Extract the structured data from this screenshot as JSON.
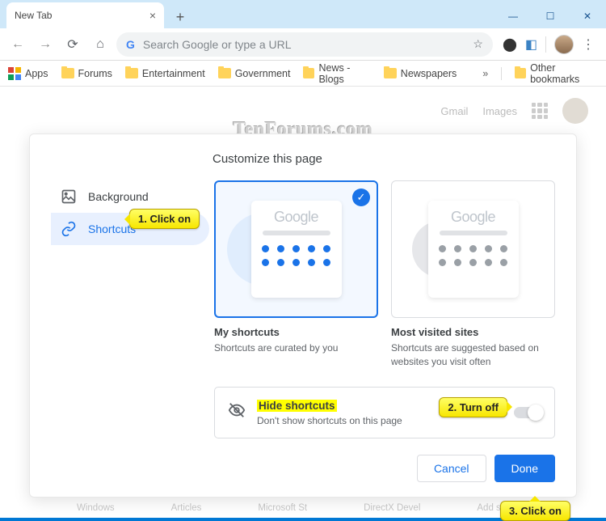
{
  "window": {
    "tab_title": "New Tab"
  },
  "omnibox": {
    "placeholder": "Search Google or type a URL"
  },
  "bookmarks": {
    "apps": "Apps",
    "items": [
      "Forums",
      "Entertainment",
      "Government",
      "News - Blogs",
      "Newspapers"
    ],
    "other": "Other bookmarks"
  },
  "toplinks": {
    "gmail": "Gmail",
    "images": "Images"
  },
  "watermark": "TenForums.com",
  "modal": {
    "title": "Customize this page",
    "nav": {
      "background": "Background",
      "shortcuts": "Shortcuts"
    },
    "cards": {
      "my_shortcuts": {
        "label": "My shortcuts",
        "desc": "Shortcuts are curated by you",
        "logo": "Google"
      },
      "most_visited": {
        "label": "Most visited sites",
        "desc": "Shortcuts are suggested based on websites you visit often",
        "logo": "Google"
      }
    },
    "hide": {
      "title": "Hide shortcuts",
      "desc": "Don't show shortcuts on this page"
    },
    "footer": {
      "cancel": "Cancel",
      "done": "Done"
    }
  },
  "callouts": {
    "c1": "1. Click on",
    "c2": "2. Turn off",
    "c3": "3. Click on"
  },
  "ghost": [
    "Windows",
    "Articles",
    "Microsoft St",
    "DirectX Devel",
    "Add shortcut"
  ]
}
